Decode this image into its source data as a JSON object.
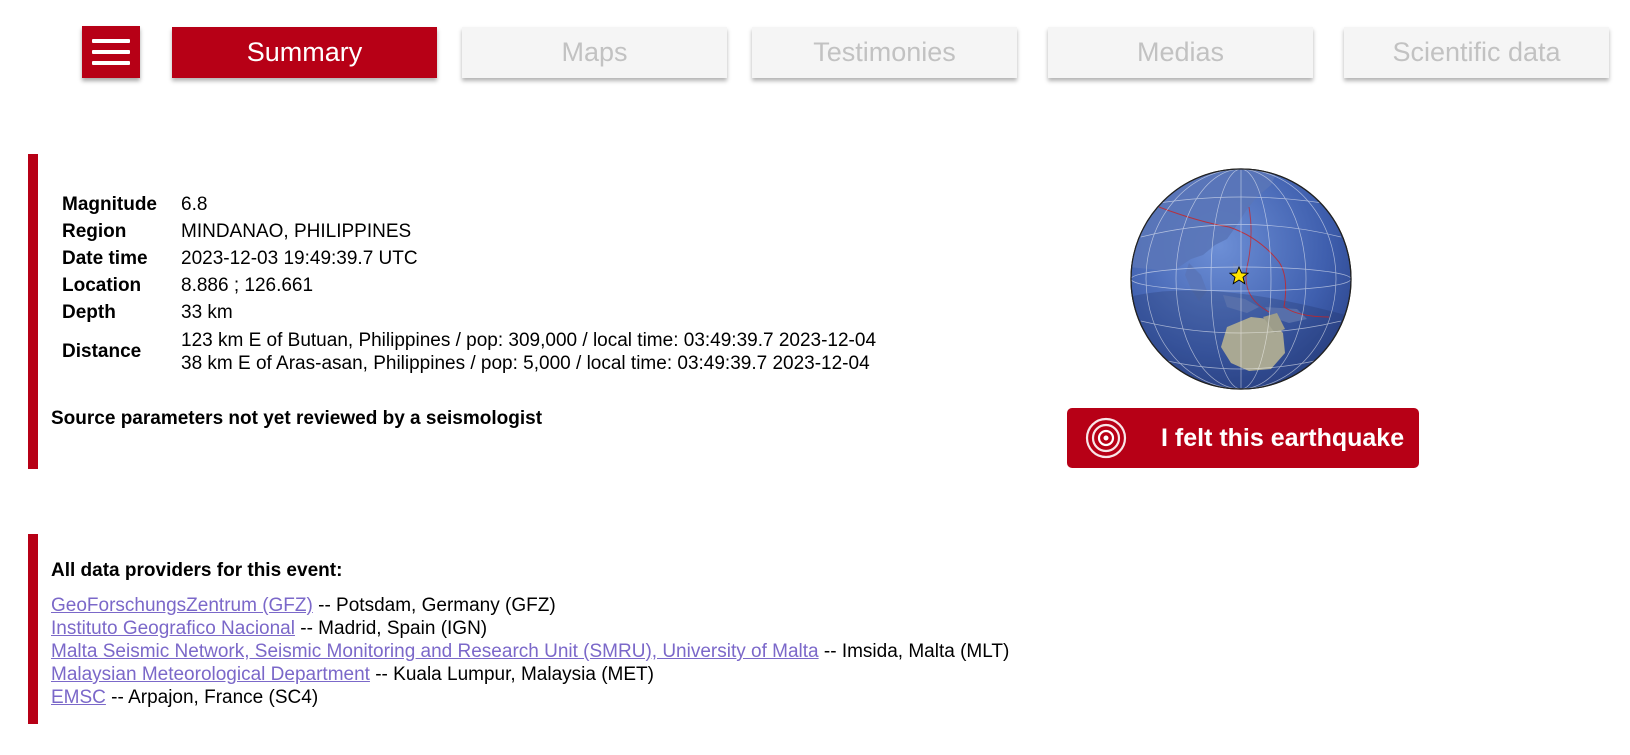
{
  "nav": {
    "menu_icon": "hamburger-menu-icon",
    "tabs": [
      {
        "label": "Summary",
        "active": true
      },
      {
        "label": "Maps",
        "active": false
      },
      {
        "label": "Testimonies",
        "active": false
      },
      {
        "label": "Medias",
        "active": false
      },
      {
        "label": "Scientific data",
        "active": false
      }
    ]
  },
  "event": {
    "rows": [
      {
        "label": "Magnitude",
        "value": "6.8"
      },
      {
        "label": "Region",
        "value": "MINDANAO, PHILIPPINES"
      },
      {
        "label": "Date time",
        "value": "2023-12-03 19:49:39.7 UTC"
      },
      {
        "label": "Location",
        "value": "8.886 ; 126.661"
      },
      {
        "label": "Depth",
        "value": "33 km"
      }
    ],
    "distance": {
      "label": "Distance",
      "lines": [
        "123 km E of Butuan, Philippines / pop: 309,000 / local time: 03:49:39.7 2023-12-04",
        "38 km E of Aras-asan, Philippines / pop: 5,000 / local time: 03:49:39.7 2023-12-04"
      ]
    },
    "review_note": "Source parameters not yet reviewed by a seismologist",
    "globe_icon": "globe-map-icon",
    "epicenter_icon": "star-icon",
    "felt_button": {
      "label": "I felt this earthquake",
      "icon": "concentric-circles-icon"
    }
  },
  "providers": {
    "title": "All data providers for this event:",
    "items": [
      {
        "link": "GeoForschungsZentrum (GFZ)",
        "suffix": " -- Potsdam, Germany (GFZ)"
      },
      {
        "link": "Instituto Geografico Nacional",
        "suffix": " -- Madrid, Spain (IGN)"
      },
      {
        "link": "Malta Seismic Network, Seismic Monitoring and Research Unit (SMRU), University of Malta",
        "suffix": " -- Imsida, Malta (MLT)"
      },
      {
        "link": "Malaysian Meteorological Department",
        "suffix": " -- Kuala Lumpur, Malaysia (MET)"
      },
      {
        "link": "EMSC",
        "suffix": " -- Arpajon, France (SC4)"
      }
    ]
  },
  "colors": {
    "brand_red": "#b70016",
    "inactive_tab_bg": "#f5f5f5",
    "inactive_tab_text": "#c2c2c2",
    "link": "#7b68c9"
  }
}
